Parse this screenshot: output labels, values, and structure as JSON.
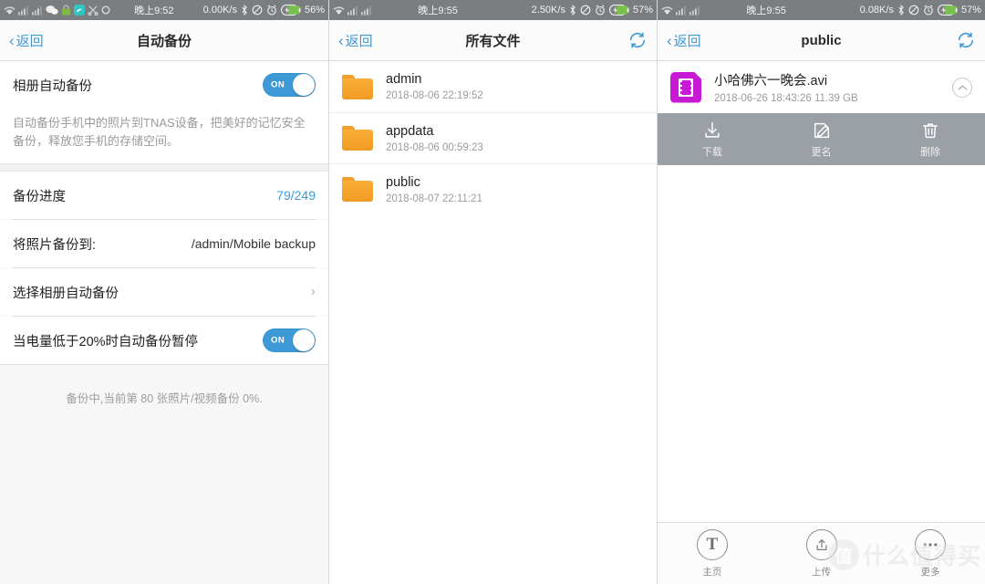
{
  "screens": [
    {
      "statusbar": {
        "time": "晚上9:52",
        "net_speed": "0.00K/s",
        "battery_pct": "56%",
        "icons": [
          "wifi-icon",
          "signal-icon",
          "signal-icon",
          "wechat-icon",
          "lock-icon",
          "app-icon",
          "scissors-icon",
          "circle-icon"
        ],
        "right_icons": [
          "bluetooth-icon",
          "mute-icon",
          "alarm-icon",
          "battery-charging-icon"
        ]
      },
      "nav": {
        "back_label": "返回",
        "title": "自动备份"
      },
      "rows": {
        "album_backup_label": "相册自动备份",
        "album_backup_toggle": "ON",
        "description": "自动备份手机中的照片到TNAS设备，把美好的记忆安全备份，释放您手机的存储空间。",
        "progress_label": "备份进度",
        "progress_value": "79/249",
        "backup_to_label": "将照片备份到:",
        "backup_to_value": "/admin/Mobile backup",
        "select_album_label": "选择相册自动备份",
        "battery_pause_label": "当电量低于20%时自动备份暂停",
        "battery_pause_toggle": "ON",
        "status_note": "备份中,当前第 80 张照片/视频备份 0%."
      }
    },
    {
      "statusbar": {
        "time": "晚上9:55",
        "net_speed": "2.50K/s",
        "battery_pct": "57%",
        "icons": [
          "wifi-icon",
          "signal-icon",
          "signal-icon"
        ],
        "right_icons": [
          "bluetooth-icon",
          "mute-icon",
          "alarm-icon",
          "battery-charging-icon"
        ]
      },
      "nav": {
        "back_label": "返回",
        "title": "所有文件",
        "right_icon": "refresh-icon"
      },
      "files": [
        {
          "name": "admin",
          "meta": "2018-08-06 22:19:52",
          "icon": "folder-icon"
        },
        {
          "name": "appdata",
          "meta": "2018-08-06 00:59:23",
          "icon": "folder-icon"
        },
        {
          "name": "public",
          "meta": "2018-08-07 22:11:21",
          "icon": "folder-icon"
        }
      ]
    },
    {
      "statusbar": {
        "time": "晚上9:55",
        "net_speed": "0.08K/s",
        "battery_pct": "57%",
        "icons": [
          "wifi-icon",
          "signal-icon",
          "signal-icon"
        ],
        "right_icons": [
          "bluetooth-icon",
          "mute-icon",
          "alarm-icon",
          "battery-charging-icon"
        ]
      },
      "nav": {
        "back_label": "返回",
        "title": "public",
        "right_icon": "refresh-icon"
      },
      "file": {
        "name": "小哈佛六一晚会.avi",
        "meta": "2018-06-26 18:43:26 11.39 GB",
        "icon": "video-file-icon",
        "collapse_icon": "chevron-up-circle-icon"
      },
      "actions": [
        {
          "label": "下载",
          "icon": "download-icon"
        },
        {
          "label": "更名",
          "icon": "rename-pencil-icon"
        },
        {
          "label": "删除",
          "icon": "trash-icon"
        }
      ],
      "tabs": [
        {
          "label": "主页",
          "icon": "home-t-icon"
        },
        {
          "label": "上传",
          "icon": "upload-icon"
        },
        {
          "label": "更多",
          "icon": "more-dots-icon"
        }
      ],
      "watermark": {
        "logo": "值",
        "text": "什么值得买"
      }
    }
  ],
  "colors": {
    "accent_blue": "#3e9ad6",
    "statusbar_bg": "#7b7e80",
    "folder_orange": "#f4a72c",
    "video_purple": "#c819d6",
    "actionbar_grey": "#9aa0a6"
  }
}
